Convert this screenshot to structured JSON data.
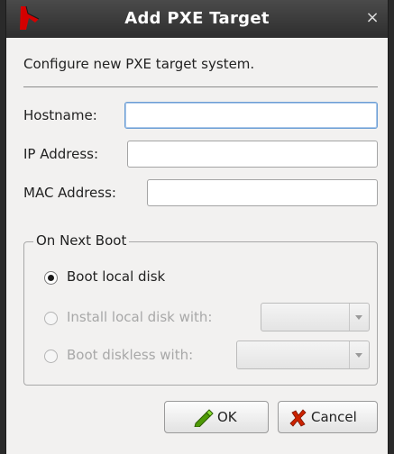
{
  "window": {
    "title": "Add PXE Target",
    "close_glyph": "×",
    "app_icon": "red-arrow-app-icon"
  },
  "intro": "Configure new PXE target system.",
  "fields": {
    "hostname": {
      "label": "Hostname:",
      "value": ""
    },
    "ip": {
      "label": "IP Address:",
      "value": ""
    },
    "mac": {
      "label": "MAC Address:",
      "value": ""
    }
  },
  "boot_group": {
    "title": "On Next Boot",
    "options": [
      {
        "label": "Boot local disk",
        "checked": true,
        "enabled": true
      },
      {
        "label": "Install local disk with:",
        "checked": false,
        "enabled": false
      },
      {
        "label": "Boot diskless with:",
        "checked": false,
        "enabled": false
      }
    ]
  },
  "buttons": {
    "ok": {
      "label": "OK",
      "icon": "green-pen-icon"
    },
    "cancel": {
      "label": "Cancel",
      "icon": "red-x-icon"
    }
  },
  "colors": {
    "titlebar": "#3a3a3a",
    "focus": "#6c9ed4",
    "ok_icon": "#4e9a06",
    "cancel_icon": "#cc2200"
  }
}
